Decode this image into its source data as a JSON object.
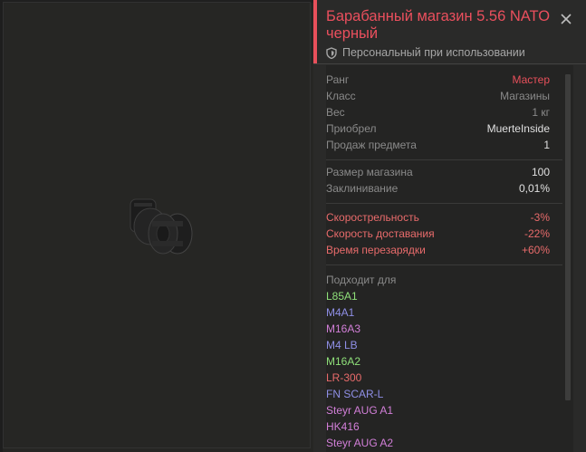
{
  "item": {
    "title": "Барабанный магазин 5.56 NATO черный",
    "subtitle": "Персональный при использовании"
  },
  "colors": {
    "accent": "#e8505b",
    "stat_negative": "#e86b6b",
    "label": "#8a8a8a",
    "value_white": "#e0e0e0"
  },
  "info": [
    {
      "key": "Ранг",
      "value": "Мастер"
    },
    {
      "key": "Класс",
      "value": "Магазины"
    },
    {
      "key": "Вес",
      "value": "1 кг"
    },
    {
      "key": "Приобрел",
      "value": "MuerteInside"
    },
    {
      "key": "Продаж предмета",
      "value": "1"
    }
  ],
  "specs": [
    {
      "key": "Размер магазина",
      "value": "100"
    },
    {
      "key": "Заклинивание",
      "value": "0,01%"
    }
  ],
  "modifiers": [
    {
      "key": "Скорострельность",
      "value": "-3%"
    },
    {
      "key": "Скорость доставания",
      "value": "-22%"
    },
    {
      "key": "Время перезарядки",
      "value": "+60%"
    }
  ],
  "compatible": {
    "header": "Подходит для",
    "weapons": [
      {
        "name": "L85A1",
        "color": "#8fe07a"
      },
      {
        "name": "M4A1",
        "color": "#8f8fe6"
      },
      {
        "name": "M16A3",
        "color": "#d27fd8"
      },
      {
        "name": "M4 LB",
        "color": "#8f8fe6"
      },
      {
        "name": "M16A2",
        "color": "#8fe07a"
      },
      {
        "name": "LR-300",
        "color": "#e86b6b"
      },
      {
        "name": "FN SCAR-L",
        "color": "#8f8fe6"
      },
      {
        "name": "Steyr AUG A1",
        "color": "#d27fd8"
      },
      {
        "name": "HK416",
        "color": "#d27fd8"
      },
      {
        "name": "Steyr AUG A2",
        "color": "#d27fd8"
      }
    ]
  },
  "icons": {
    "close": "close-icon",
    "shield": "shield-icon"
  }
}
